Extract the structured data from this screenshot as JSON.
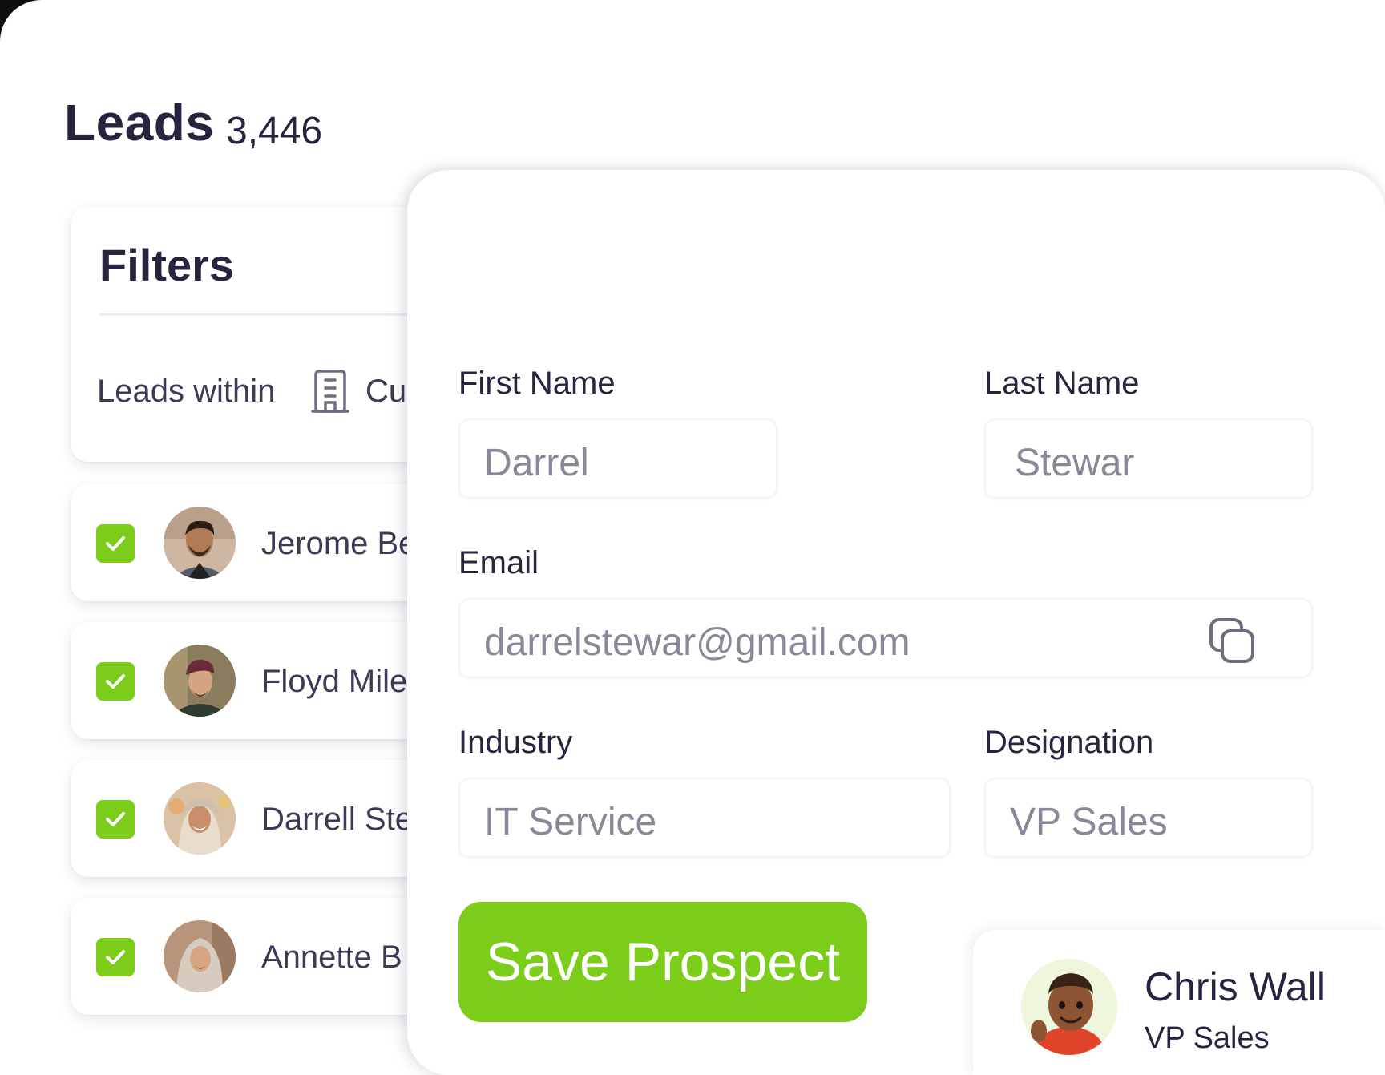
{
  "header": {
    "title": "Leads",
    "count": "3,446"
  },
  "filters": {
    "title": "Filters",
    "row_label": "Leads within",
    "row_value": "Cu"
  },
  "leads": [
    {
      "name": "Jerome Be",
      "checked": true
    },
    {
      "name": "Floyd Mile",
      "checked": true
    },
    {
      "name": "Darrell Ste",
      "checked": true
    },
    {
      "name": "Annette B",
      "checked": true
    }
  ],
  "form": {
    "first_name_label": "First Name",
    "first_name_value": "Darrel",
    "last_name_label": "Last Name",
    "last_name_value": "Stewar",
    "email_label": "Email",
    "email_value": "darrelstewar@gmail.com",
    "industry_label": "Industry",
    "industry_value": "IT Service",
    "designation_label": "Designation",
    "designation_value": "VP Sales",
    "save_label": "Save Prospect"
  },
  "profile": {
    "name": "Chris Wall",
    "title": "VP Sales"
  },
  "colors": {
    "accent": "#7ccd1a",
    "text": "#2a2340",
    "muted": "#8a8799"
  },
  "icons": {
    "building": "building-icon",
    "check": "check-icon",
    "copy": "copy-icon"
  }
}
